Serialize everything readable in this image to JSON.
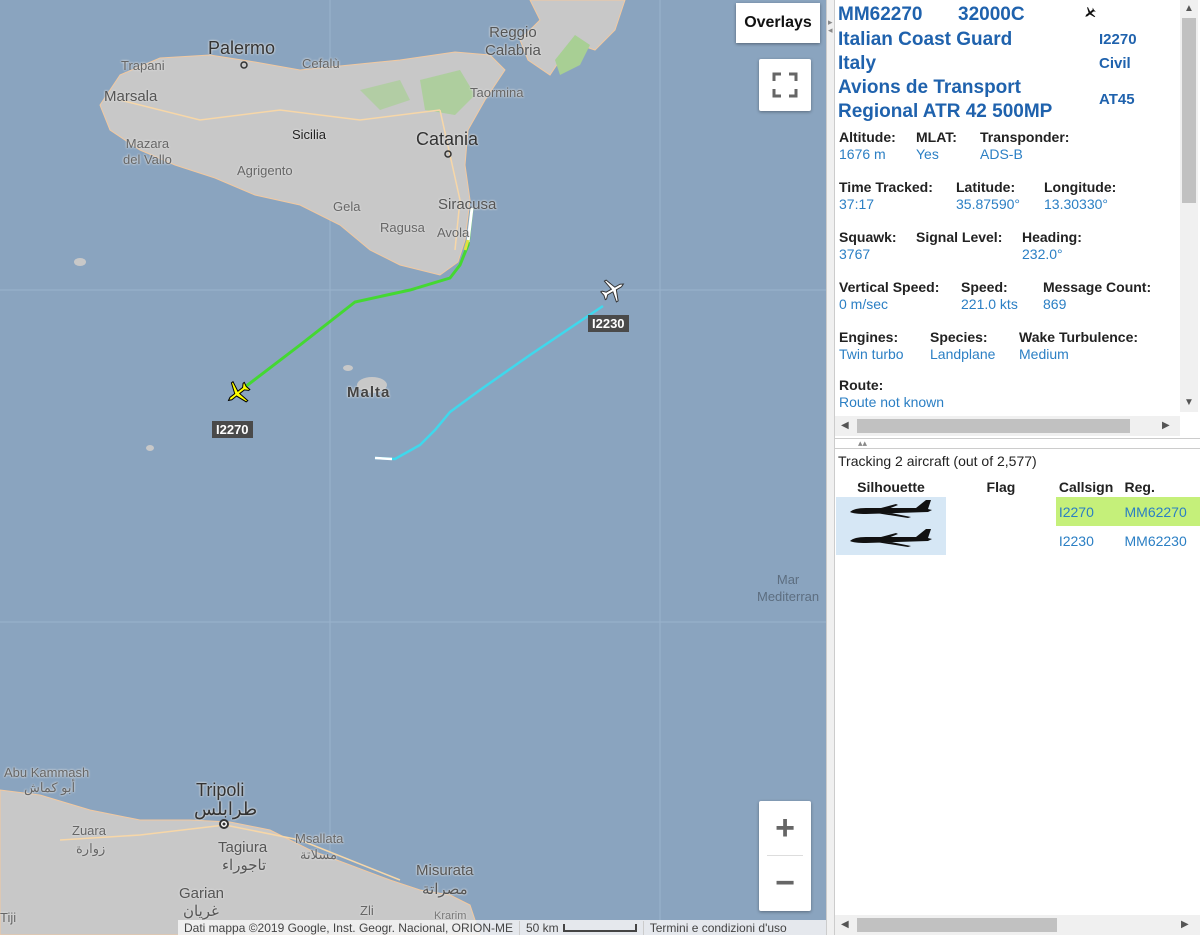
{
  "map": {
    "labels": {
      "palermo": "Palermo",
      "trapani": "Trapani",
      "marsala": "Marsala",
      "mazara": "Mazara\ndel Vallo",
      "cefalu": "Cefalù",
      "sicilia": "Sicilia",
      "agrigento": "Agrigento",
      "gela": "Gela",
      "ragusa": "Ragusa",
      "avola": "Avola",
      "siracusa": "Siracusa",
      "catania": "Catania",
      "taormina": "Taormina",
      "reggio": "Reggio\nCalabria",
      "malta": "Malta",
      "mar": "Mar\nMediterran",
      "abu_kammash": "Abu Kammash",
      "abu_kammash_ar": "أبو كماش",
      "zuara": "Zuara",
      "zuara_ar": "زوارة",
      "tripoli": "Tripoli",
      "tripoli_ar": "طرابلس",
      "tagiura": "Tagiura",
      "tagiura_ar": "تاجوراء",
      "msallata": "Msallata",
      "msallata_ar": "مسلاتة",
      "garian": "Garian",
      "garian_ar": "غريان",
      "misurata": "Misurata",
      "misurata_ar": "مصراتة",
      "tiji": "Tiji",
      "zli": "Zli",
      "krarim": "Krarim"
    },
    "aircraft": [
      {
        "callsign": "I2270",
        "color": "#ffff00",
        "selected": true
      },
      {
        "callsign": "I2230",
        "color": "#ffffff",
        "selected": false
      }
    ],
    "overlays_label": "Overlays",
    "zoom_in": "+",
    "zoom_out": "−",
    "attribution": {
      "data": "Dati mappa ©2019 Google, Inst. Geogr. Nacional, ORION-ME",
      "scale": "50 km",
      "terms": "Termini e condizioni d'uso"
    }
  },
  "info": {
    "registration": "MM62270",
    "icao": "32000C",
    "operator": "Italian Coast Guard",
    "callsign": "I2270",
    "country": "Italy",
    "category": "Civil",
    "type_line1": "Avions de Transport",
    "type_line2": "Regional ATR 42 500MP",
    "type_code": "AT45",
    "fields": {
      "altitude": {
        "label": "Altitude:",
        "value": "1676 m"
      },
      "mlat": {
        "label": "MLAT:",
        "value": "Yes"
      },
      "transponder": {
        "label": "Transponder:",
        "value": "ADS-B"
      },
      "time_tracked": {
        "label": "Time Tracked:",
        "value": "37:17"
      },
      "latitude": {
        "label": "Latitude:",
        "value": "35.87590°"
      },
      "longitude": {
        "label": "Longitude:",
        "value": "13.30330°"
      },
      "squawk": {
        "label": "Squawk:",
        "value": "3767"
      },
      "signal": {
        "label": "Signal Level:",
        "value": ""
      },
      "heading": {
        "label": "Heading:",
        "value": "232.0°"
      },
      "vspeed": {
        "label": "Vertical Speed:",
        "value": "0 m/sec"
      },
      "speed": {
        "label": "Speed:",
        "value": "221.0 kts"
      },
      "msgcount": {
        "label": "Message Count:",
        "value": "869"
      },
      "engines": {
        "label": "Engines:",
        "value": "Twin turbo"
      },
      "species": {
        "label": "Species:",
        "value": "Landplane"
      },
      "wake": {
        "label": "Wake Turbulence:",
        "value": "Medium"
      },
      "route": {
        "label": "Route:",
        "value": "Route not known"
      }
    }
  },
  "list": {
    "tracking": "Tracking 2 aircraft (out of 2,577)",
    "columns": [
      "Silhouette",
      "Flag",
      "Callsign",
      "Reg."
    ],
    "rows": [
      {
        "callsign": "I2270",
        "reg": "MM62270",
        "highlight": "#c5f07a"
      },
      {
        "callsign": "I2230",
        "reg": "MM62230",
        "highlight": ""
      }
    ]
  }
}
